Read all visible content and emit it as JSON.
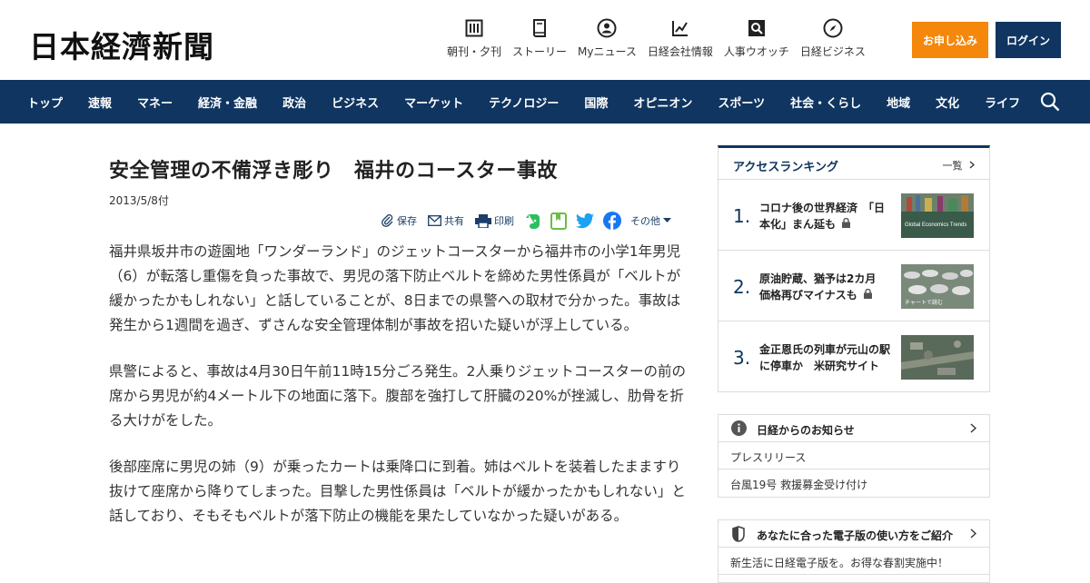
{
  "header": {
    "logo": "日本経濟新聞",
    "nav": [
      {
        "label": "朝刊・夕刊",
        "icon": "newspaper-icon"
      },
      {
        "label": "ストーリー",
        "icon": "book-icon"
      },
      {
        "label": "Myニュース",
        "icon": "person-icon"
      },
      {
        "label": "日経会社情報",
        "icon": "chart-icon"
      },
      {
        "label": "人事ウオッチ",
        "icon": "search-person-icon"
      },
      {
        "label": "日経ビジネス",
        "icon": "compass-icon"
      }
    ],
    "subscribe_label": "お申し込み",
    "login_label": "ログイン"
  },
  "categories": [
    "トップ",
    "速報",
    "マネー",
    "経済・金融",
    "政治",
    "ビジネス",
    "マーケット",
    "テクノロジー",
    "国際",
    "オピニオン",
    "スポーツ",
    "社会・くらし",
    "地域",
    "文化",
    "ライフ"
  ],
  "article": {
    "title": "安全管理の不備浮き彫り　福井のコースター事故",
    "date": "2013/5/8付",
    "share": {
      "save": "保存",
      "share": "共有",
      "print": "印刷",
      "other": "その他"
    },
    "paragraphs": [
      "福井県坂井市の遊園地「ワンダーランド」のジェットコースターから福井市の小学1年男児（6）が転落し重傷を負った事故で、男児の落下防止ベルトを締めた男性係員が「ベルトが緩かったかもしれない」と話していることが、8日までの県警への取材で分かった。事故は発生から1週間を過ぎ、ずさんな安全管理体制が事故を招いた疑いが浮上している。",
      "県警によると、事故は4月30日午前11時15分ごろ発生。2人乗りジェットコースターの前の席から男児が約4メートル下の地面に落下。腹部を強打して肝臓の20%が挫滅し、肋骨を折る大けがをした。",
      "後部座席に男児の姉（9）が乗ったカートは乗降口に到着。姉はベルトを装着したまますり抜けて座席から降りてしまった。目撃した男性係員は「ベルトが緩かったかもしれない」と話しており、そもそもベルトが落下防止の機能を果たしていなかった疑いがある。"
    ]
  },
  "ranking": {
    "title": "アクセスランキング",
    "more": "一覧",
    "items": [
      {
        "num": "1.",
        "text": "コロナ後の世界経済　「日本化」まん延も",
        "thumb_caption": "Global Economics Trends"
      },
      {
        "num": "2.",
        "text": "原油貯蔵、猶予は2カ月　価格再びマイナスも",
        "thumb_caption": "チャートで読む"
      },
      {
        "num": "3.",
        "text": "金正恩氏の列車が元山の駅に停車か　米研究サイト",
        "thumb_caption": ""
      }
    ]
  },
  "notice": {
    "title": "日経からのお知らせ",
    "items": [
      "プレスリリース",
      "台風19号 救援募金受け付け"
    ]
  },
  "guide": {
    "title": "あなたに合った電子版の使い方をご紹介",
    "items": [
      "新生活に日経電子版を。お得な春割実施中！"
    ]
  },
  "colors": {
    "navy": "#0f3560",
    "orange": "#f5870a"
  }
}
